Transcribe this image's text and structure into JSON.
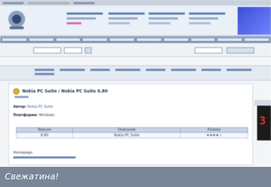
{
  "content": {
    "title": "Nokia PC Suite / Nokia PC Suite 6.80",
    "info": [
      {
        "label": "Автор:",
        "text": "Nokia PC Suite"
      },
      {
        "label": "Платформа:",
        "text": "Windows"
      }
    ],
    "table": {
      "headers": [
        "Версия",
        "Описание",
        "Размер"
      ],
      "rows": [
        [
          "6.80",
          "Nokia PC Suite",
          "★★★★☆"
        ]
      ]
    },
    "homepage_label": "Homepage:"
  },
  "side_widget": {
    "number": "3"
  },
  "caption": {
    "text": "Свежатина!"
  }
}
